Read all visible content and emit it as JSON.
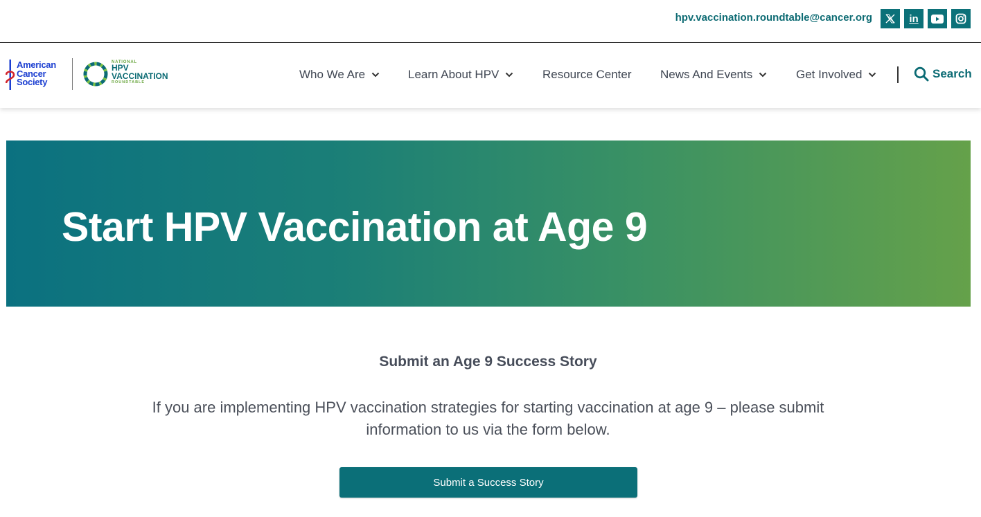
{
  "topbar": {
    "email": "hpv.vaccination.roundtable@cancer.org",
    "social": [
      {
        "icon": "x-twitter-icon"
      },
      {
        "icon": "linkedin-icon",
        "glyph": "in"
      },
      {
        "icon": "youtube-icon"
      },
      {
        "icon": "instagram-icon"
      }
    ]
  },
  "header": {
    "logo_acs": {
      "line1": "American",
      "line2": "Cancer",
      "line3": "Society"
    },
    "logo_hpv": {
      "line1": "NATIONAL",
      "line2": "HPV",
      "line3": "VACCINATION",
      "line4": "ROUNDTABLE"
    },
    "nav": [
      {
        "label": "Who We Are",
        "has_dropdown": true
      },
      {
        "label": "Learn About HPV",
        "has_dropdown": true
      },
      {
        "label": "Resource Center",
        "has_dropdown": false
      },
      {
        "label": "News And Events",
        "has_dropdown": true
      },
      {
        "label": "Get Involved",
        "has_dropdown": true
      }
    ],
    "search_label": "Search"
  },
  "hero": {
    "title": "Start HPV Vaccination at Age 9"
  },
  "main": {
    "section_title": "Submit an Age 9 Success Story",
    "section_text": "If you are implementing HPV vaccination strategies for starting vaccination at age 9 – please submit information to us via the form below.",
    "cta_label": "Submit a Success Story"
  },
  "colors": {
    "brand_teal": "#0b6f78",
    "acs_blue": "#1c3fd1",
    "hero_gradient_start": "#0b7180",
    "hero_gradient_end": "#65a14a"
  }
}
